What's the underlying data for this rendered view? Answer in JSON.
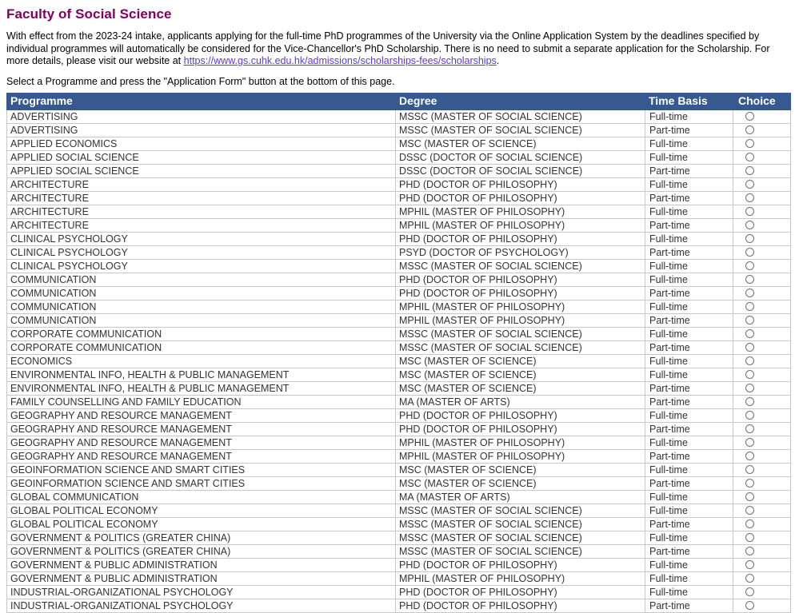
{
  "page": {
    "title": "Faculty of Social Science",
    "intro_before_link": "With effect from the 2023-24 intake, applicants applying for the full-time PhD programmes of the University via the Online Application System by the deadlines specified by individual programmes will automatically be considered for the Vice-Chancellor's PhD Scholarship. There is no need to submit a separate application for the Scholarship. For more details, please visit our website at ",
    "link_text": "https://www.gs.cuhk.edu.hk/admissions/scholarships-fees/scholarships",
    "intro_after_link": ".",
    "instruction": "Select a Programme and press the \"Application Form\" button at the bottom of this page.",
    "title_color": "#800060",
    "header_bg_color": "#36598f",
    "link_color": "#5b3bd4"
  },
  "table": {
    "columns": {
      "programme": "Programme",
      "degree": "Degree",
      "time_basis": "Time Basis",
      "choice": "Choice"
    },
    "rows": [
      {
        "programme": "ADVERTISING",
        "degree": "MSSC (MASTER OF SOCIAL SCIENCE)",
        "time_basis": "Full-time",
        "choice": "radio-unselected"
      },
      {
        "programme": "ADVERTISING",
        "degree": "MSSC (MASTER OF SOCIAL SCIENCE)",
        "time_basis": "Part-time",
        "choice": "radio-unselected"
      },
      {
        "programme": "APPLIED ECONOMICS",
        "degree": "MSC (MASTER OF SCIENCE)",
        "time_basis": "Full-time",
        "choice": "radio-unselected"
      },
      {
        "programme": "APPLIED SOCIAL SCIENCE",
        "degree": "DSSC (DOCTOR OF SOCIAL SCIENCE)",
        "time_basis": "Full-time",
        "choice": "radio-unselected"
      },
      {
        "programme": "APPLIED SOCIAL SCIENCE",
        "degree": "DSSC (DOCTOR OF SOCIAL SCIENCE)",
        "time_basis": "Part-time",
        "choice": "radio-unselected"
      },
      {
        "programme": "ARCHITECTURE",
        "degree": "PHD (DOCTOR OF PHILOSOPHY)",
        "time_basis": "Full-time",
        "choice": "radio-unselected"
      },
      {
        "programme": "ARCHITECTURE",
        "degree": "PHD (DOCTOR OF PHILOSOPHY)",
        "time_basis": "Part-time",
        "choice": "radio-unselected"
      },
      {
        "programme": "ARCHITECTURE",
        "degree": "MPHIL (MASTER OF PHILOSOPHY)",
        "time_basis": "Full-time",
        "choice": "radio-unselected"
      },
      {
        "programme": "ARCHITECTURE",
        "degree": "MPHIL (MASTER OF PHILOSOPHY)",
        "time_basis": "Part-time",
        "choice": "radio-unselected"
      },
      {
        "programme": "CLINICAL PSYCHOLOGY",
        "degree": "PHD (DOCTOR OF PHILOSOPHY)",
        "time_basis": "Full-time",
        "choice": "radio-unselected"
      },
      {
        "programme": "CLINICAL PSYCHOLOGY",
        "degree": "PSYD (DOCTOR OF PSYCHOLOGY)",
        "time_basis": "Part-time",
        "choice": "radio-unselected"
      },
      {
        "programme": "CLINICAL PSYCHOLOGY",
        "degree": "MSSC (MASTER OF SOCIAL SCIENCE)",
        "time_basis": "Full-time",
        "choice": "radio-unselected"
      },
      {
        "programme": "COMMUNICATION",
        "degree": "PHD (DOCTOR OF PHILOSOPHY)",
        "time_basis": "Full-time",
        "choice": "radio-unselected"
      },
      {
        "programme": "COMMUNICATION",
        "degree": "PHD (DOCTOR OF PHILOSOPHY)",
        "time_basis": "Part-time",
        "choice": "radio-unselected"
      },
      {
        "programme": "COMMUNICATION",
        "degree": "MPHIL (MASTER OF PHILOSOPHY)",
        "time_basis": "Full-time",
        "choice": "radio-unselected"
      },
      {
        "programme": "COMMUNICATION",
        "degree": "MPHIL (MASTER OF PHILOSOPHY)",
        "time_basis": "Part-time",
        "choice": "radio-unselected"
      },
      {
        "programme": "CORPORATE COMMUNICATION",
        "degree": "MSSC (MASTER OF SOCIAL SCIENCE)",
        "time_basis": "Full-time",
        "choice": "radio-unselected"
      },
      {
        "programme": "CORPORATE COMMUNICATION",
        "degree": "MSSC (MASTER OF SOCIAL SCIENCE)",
        "time_basis": "Part-time",
        "choice": "radio-unselected"
      },
      {
        "programme": "ECONOMICS",
        "degree": "MSC (MASTER OF SCIENCE)",
        "time_basis": "Full-time",
        "choice": "radio-unselected"
      },
      {
        "programme": "ENVIRONMENTAL INFO, HEALTH & PUBLIC MANAGEMENT",
        "degree": "MSC (MASTER OF SCIENCE)",
        "time_basis": "Full-time",
        "choice": "radio-unselected"
      },
      {
        "programme": "ENVIRONMENTAL INFO, HEALTH & PUBLIC MANAGEMENT",
        "degree": "MSC (MASTER OF SCIENCE)",
        "time_basis": "Part-time",
        "choice": "radio-unselected"
      },
      {
        "programme": "FAMILY COUNSELLING AND FAMILY EDUCATION",
        "degree": "MA (MASTER OF ARTS)",
        "time_basis": "Part-time",
        "choice": "radio-unselected"
      },
      {
        "programme": "GEOGRAPHY AND RESOURCE MANAGEMENT",
        "degree": "PHD (DOCTOR OF PHILOSOPHY)",
        "time_basis": "Full-time",
        "choice": "radio-unselected"
      },
      {
        "programme": "GEOGRAPHY AND RESOURCE MANAGEMENT",
        "degree": "PHD (DOCTOR OF PHILOSOPHY)",
        "time_basis": "Part-time",
        "choice": "radio-unselected"
      },
      {
        "programme": "GEOGRAPHY AND RESOURCE MANAGEMENT",
        "degree": "MPHIL (MASTER OF PHILOSOPHY)",
        "time_basis": "Full-time",
        "choice": "radio-unselected"
      },
      {
        "programme": "GEOGRAPHY AND RESOURCE MANAGEMENT",
        "degree": "MPHIL (MASTER OF PHILOSOPHY)",
        "time_basis": "Part-time",
        "choice": "radio-unselected"
      },
      {
        "programme": "GEOINFORMATION SCIENCE AND SMART CITIES",
        "degree": "MSC (MASTER OF SCIENCE)",
        "time_basis": "Full-time",
        "choice": "radio-unselected"
      },
      {
        "programme": "GEOINFORMATION SCIENCE AND SMART CITIES",
        "degree": "MSC (MASTER OF SCIENCE)",
        "time_basis": "Part-time",
        "choice": "radio-unselected"
      },
      {
        "programme": "GLOBAL COMMUNICATION",
        "degree": "MA (MASTER OF ARTS)",
        "time_basis": "Full-time",
        "choice": "radio-unselected"
      },
      {
        "programme": "GLOBAL POLITICAL ECONOMY",
        "degree": "MSSC (MASTER OF SOCIAL SCIENCE)",
        "time_basis": "Full-time",
        "choice": "radio-unselected"
      },
      {
        "programme": "GLOBAL POLITICAL ECONOMY",
        "degree": "MSSC (MASTER OF SOCIAL SCIENCE)",
        "time_basis": "Part-time",
        "choice": "radio-unselected"
      },
      {
        "programme": "GOVERNMENT & POLITICS (GREATER CHINA)",
        "degree": "MSSC (MASTER OF SOCIAL SCIENCE)",
        "time_basis": "Full-time",
        "choice": "radio-unselected"
      },
      {
        "programme": "GOVERNMENT & POLITICS (GREATER CHINA)",
        "degree": "MSSC (MASTER OF SOCIAL SCIENCE)",
        "time_basis": "Part-time",
        "choice": "radio-unselected"
      },
      {
        "programme": "GOVERNMENT & PUBLIC ADMINISTRATION",
        "degree": "PHD (DOCTOR OF PHILOSOPHY)",
        "time_basis": "Full-time",
        "choice": "radio-unselected"
      },
      {
        "programme": "GOVERNMENT & PUBLIC ADMINISTRATION",
        "degree": "MPHIL (MASTER OF PHILOSOPHY)",
        "time_basis": "Full-time",
        "choice": "radio-unselected"
      },
      {
        "programme": "INDUSTRIAL-ORGANIZATIONAL PSYCHOLOGY",
        "degree": "PHD (DOCTOR OF PHILOSOPHY)",
        "time_basis": "Full-time",
        "choice": "radio-unselected"
      },
      {
        "programme": "INDUSTRIAL-ORGANIZATIONAL PSYCHOLOGY",
        "degree": "PHD (DOCTOR OF PHILOSOPHY)",
        "time_basis": "Part-time",
        "choice": "radio-unselected"
      }
    ]
  }
}
